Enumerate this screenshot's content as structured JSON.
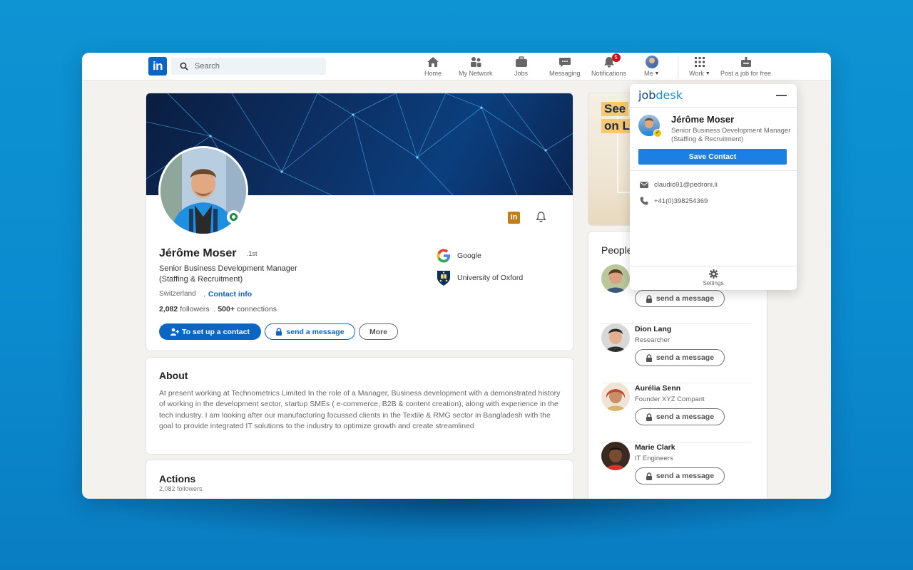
{
  "nav": {
    "logo": "in",
    "search_placeholder": "Search",
    "items": [
      {
        "label": "Home",
        "icon": "home-icon"
      },
      {
        "label": "My Network",
        "icon": "network-icon"
      },
      {
        "label": "Jobs",
        "icon": "briefcase-icon"
      },
      {
        "label": "Messaging",
        "icon": "messaging-icon"
      },
      {
        "label": "Notifications",
        "icon": "bell-icon",
        "badge": "5"
      },
      {
        "label": "Me",
        "icon": "avatar"
      },
      {
        "label": "Work",
        "icon": "grid-icon"
      },
      {
        "label": "Post a job for free",
        "icon": "post-job-icon"
      }
    ]
  },
  "profile": {
    "name": "Jérôme Moser",
    "degree": "1st",
    "headline": "Senior Business Development Manager (Staffing & Recruitment)",
    "location": "Switzerland",
    "contact_info": "Contact info",
    "followers_count": "2,082",
    "followers_label": "followers",
    "connections_count": "500+",
    "connections_label": "connections",
    "buttons": {
      "primary": "To set up a contact",
      "message": "send a message",
      "more": "More"
    },
    "organizations": [
      {
        "name": "Google",
        "icon": "google-icon"
      },
      {
        "name": "University of Oxford",
        "icon": "oxford-crest-icon"
      }
    ]
  },
  "about": {
    "title": "About",
    "text": "At present working at Technometrics Limited In the role of a Manager, Business development with a demonstrated history of working in the development sector, startup SMEs ( e-commerce, B2B & content creation), along with experience in the tech industry. I am looking after our manufacturing focussed clients in the Textile & RMG sector in Bangladesh with the goal to provide integrated IT solutions to the industry to optimize growth and create streamlined"
  },
  "actions": {
    "title": "Actions",
    "subtitle": "2,082 followers"
  },
  "ad": {
    "line1": "See",
    "line2": "on L"
  },
  "people": {
    "title": "People",
    "list": [
      {
        "name": "",
        "role": "",
        "button": "send a message"
      },
      {
        "name": "Dion Lang",
        "role": "Researcher",
        "button": "send a message"
      },
      {
        "name": "Aurélia Senn",
        "role": "Founder XYZ Compant",
        "button": "send a message"
      },
      {
        "name": "Marie Clark",
        "role": "IT Engineers",
        "button": "send a message"
      }
    ]
  },
  "jobdesk": {
    "logo_prefix": "job",
    "logo_suffix": "desk",
    "name": "Jérôme Moser",
    "title": "Senior Business Development Manager (Staffing & Recruitment)",
    "save_button": "Save Contact",
    "email": "claudio91@pedroni.li",
    "phone": "+41(0)398254369",
    "settings_label": "Settings"
  },
  "colors": {
    "linkedin_blue": "#0a66c2",
    "jobdesk_blue": "#1b7fe3",
    "background": "#0e93d3",
    "badge_red": "#cc1016",
    "online_green": "#1a8d3f"
  }
}
